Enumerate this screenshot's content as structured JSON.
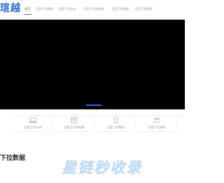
{
  "brand": {
    "logo_text": "瑄越"
  },
  "nav": {
    "items": [
      {
        "label": "首页",
        "active": true
      },
      {
        "label": "百度下拉数据"
      },
      {
        "label": "百度下拉动态"
      },
      {
        "label": "百度下拉如何做"
      },
      {
        "label": "百度下拉赚钱"
      },
      {
        "label": "百度下拉推荐"
      }
    ],
    "accent_color": "#3a7ce0"
  },
  "features": [
    {
      "label": "百度下拉动态",
      "icon": "laptop-icon"
    },
    {
      "label": "百度下拉如何做",
      "icon": "browser-window-icon"
    },
    {
      "label": "百度下拉赚钱",
      "icon": "phone-icon"
    },
    {
      "label": "百度下拉推荐",
      "icon": "people-icon"
    }
  ],
  "section": {
    "title": "下拉数据"
  },
  "watermark": {
    "text": "星链秒收录"
  }
}
